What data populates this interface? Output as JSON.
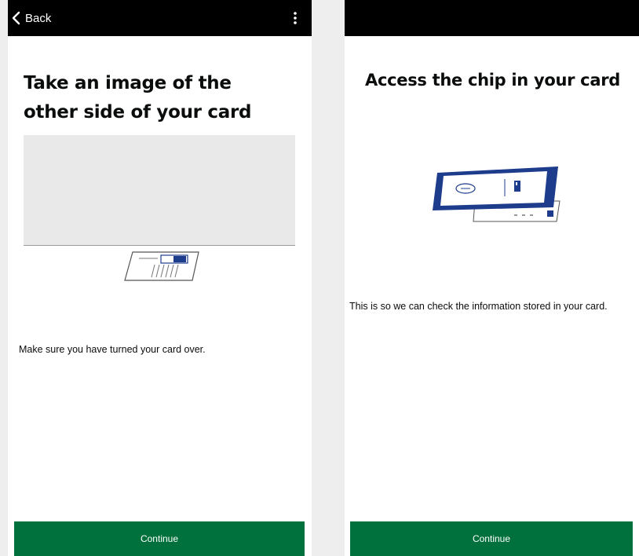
{
  "screens": {
    "left": {
      "back_label": "Back",
      "title": "Take an image of the other side of your card",
      "body": "Make sure you have turned your card over.",
      "continue_label": "Continue"
    },
    "right": {
      "title": "Access the chip in your card",
      "body": "This is so we can check the information stored in your card.",
      "continue_label": "Continue"
    }
  },
  "icons": {
    "back": "chevron-left-icon",
    "menu": "more-vertical-icon",
    "card_back": "id-card-back-illustration",
    "chip_reader": "phone-reading-card-illustration"
  },
  "colors": {
    "topbar": "#000000",
    "button": "#00703c",
    "button_text": "#ffffff",
    "text": "#0b0c0c",
    "page_background": "#eeeeee",
    "illustration_accent": "#1d3c8c"
  }
}
